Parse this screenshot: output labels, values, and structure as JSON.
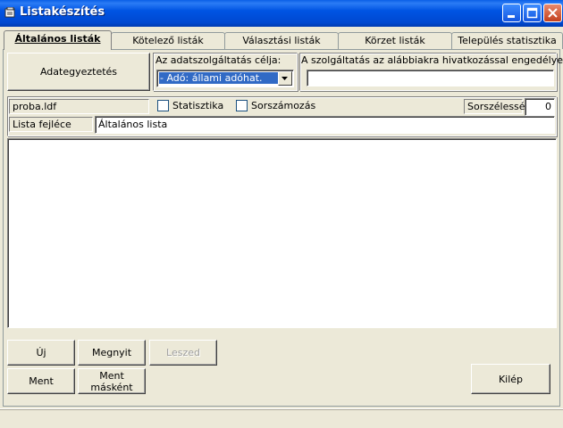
{
  "window": {
    "title": "Listakészítés"
  },
  "tabs": [
    {
      "label": "Általános listák",
      "active": true
    },
    {
      "label": "Kötelező listák",
      "active": false
    },
    {
      "label": "Választási listák",
      "active": false
    },
    {
      "label": "Körzet listák",
      "active": false
    },
    {
      "label": "Település statisztika",
      "active": false
    }
  ],
  "top": {
    "sync_button": "Adategyeztetés",
    "purpose_label": "Az adatszolgáltatás célja:",
    "purpose_value": "- Adó: állami adóhat.",
    "permit_label": "A szolgáltatás az alábbiakra hivatkozással engedélyezve:",
    "permit_value": ""
  },
  "file": {
    "name": "proba.ldf",
    "statistics_label": "Statisztika",
    "statistics_checked": false,
    "numbering_label": "Sorszámozás",
    "numbering_checked": false,
    "width_label": "Sorszélesség",
    "width_value": "0",
    "header_label": "Lista fejléce",
    "header_value": "Általános lista"
  },
  "buttons": {
    "new": "Új",
    "open": "Megnyit",
    "remove": "Leszed",
    "save": "Ment",
    "save_as": "Ment másként",
    "exit": "Kilép"
  }
}
